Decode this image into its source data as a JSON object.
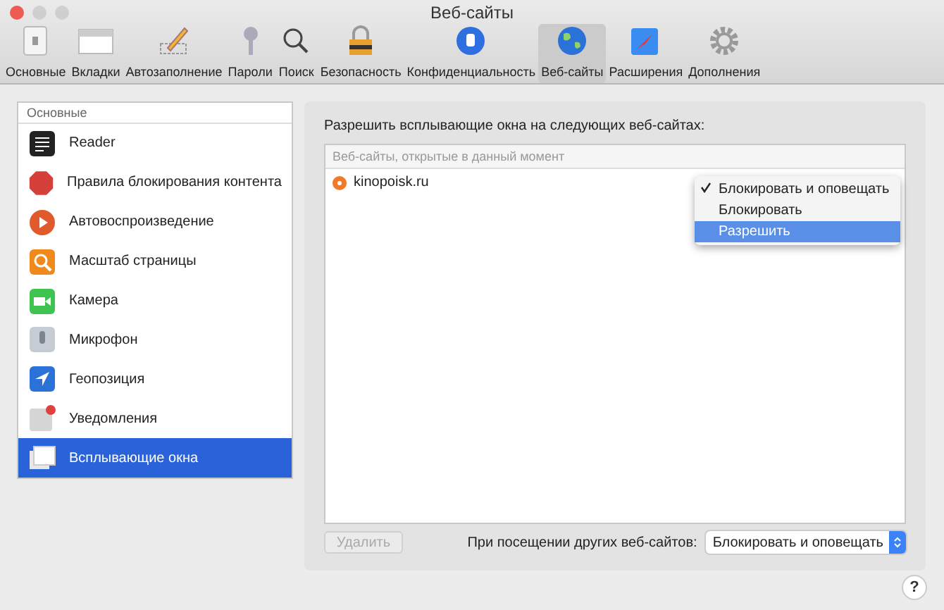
{
  "window": {
    "title": "Веб-сайты"
  },
  "toolbar": [
    {
      "label": "Основные",
      "kind": "switch",
      "selected": false
    },
    {
      "label": "Вкладки",
      "kind": "tabs",
      "selected": false
    },
    {
      "label": "Автозаполнение",
      "kind": "pencil",
      "selected": false
    },
    {
      "label": "Пароли",
      "kind": "key",
      "selected": false
    },
    {
      "label": "Поиск",
      "kind": "search",
      "selected": false
    },
    {
      "label": "Безопасность",
      "kind": "lock",
      "selected": false
    },
    {
      "label": "Конфиденциальность",
      "kind": "hand",
      "selected": false
    },
    {
      "label": "Веб-сайты",
      "kind": "globe",
      "selected": true
    },
    {
      "label": "Расширения",
      "kind": "puzzle",
      "selected": false
    },
    {
      "label": "Дополнения",
      "kind": "gear",
      "selected": false
    }
  ],
  "sidebar": {
    "header": "Основные",
    "items": [
      {
        "label": "Reader",
        "kind": "reader",
        "selected": false
      },
      {
        "label": "Правила блокирования контента",
        "kind": "stop",
        "selected": false
      },
      {
        "label": "Автовоспроизведение",
        "kind": "play",
        "selected": false
      },
      {
        "label": "Масштаб страницы",
        "kind": "zoom",
        "selected": false
      },
      {
        "label": "Камера",
        "kind": "camera",
        "selected": false
      },
      {
        "label": "Микрофон",
        "kind": "mic",
        "selected": false
      },
      {
        "label": "Геопозиция",
        "kind": "location",
        "selected": false
      },
      {
        "label": "Уведомления",
        "kind": "notify",
        "selected": false
      },
      {
        "label": "Всплывающие окна",
        "kind": "popup",
        "selected": true
      }
    ]
  },
  "panel": {
    "heading": "Разрешить всплывающие окна на следующих веб-сайтах:",
    "table_header": "Веб-сайты, открытые в данный момент",
    "sites": [
      {
        "name": "kinopoisk.ru"
      }
    ],
    "menu": [
      {
        "label": "Блокировать и оповещать",
        "checked": true,
        "selected": false
      },
      {
        "label": "Блокировать",
        "checked": false,
        "selected": false
      },
      {
        "label": "Разрешить",
        "checked": false,
        "selected": true
      }
    ],
    "remove_button": {
      "label": "Удалить",
      "disabled": true
    },
    "other_label": "При посещении других веб-сайтов:",
    "other_value": "Блокировать и оповещать"
  },
  "help": "?"
}
